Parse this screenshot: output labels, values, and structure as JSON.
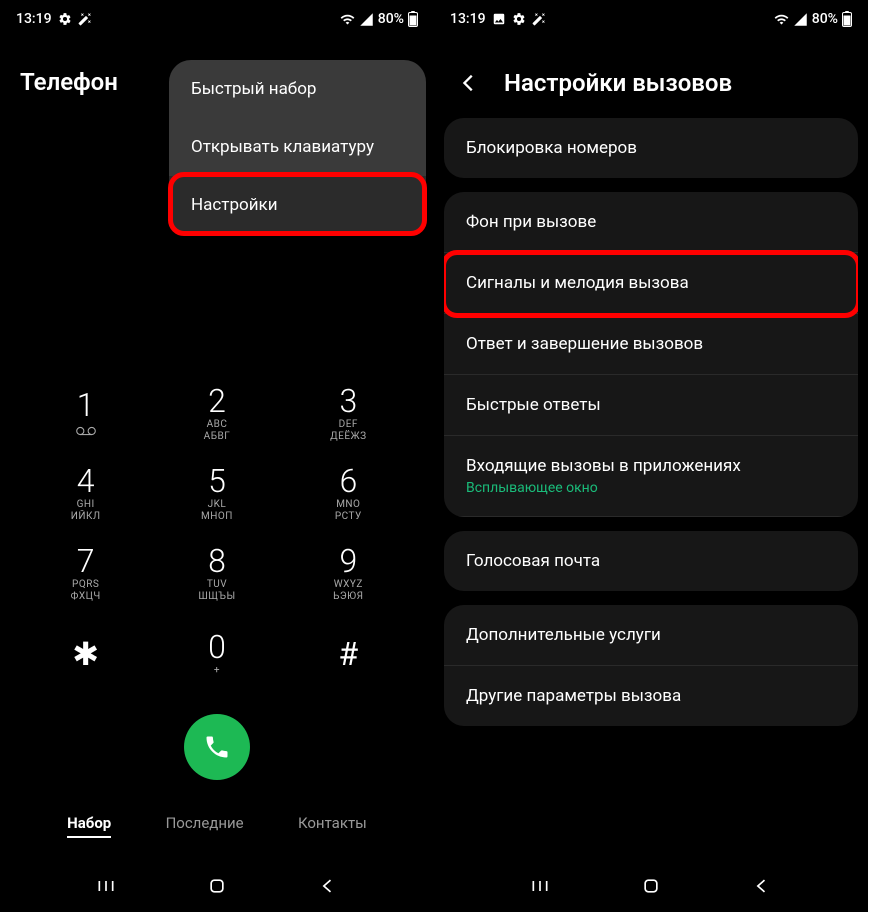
{
  "status": {
    "time": "13:19",
    "battery": "80%"
  },
  "left": {
    "title": "Телефон",
    "menu": {
      "item1": "Быстрый набор",
      "item2": "Открывать клавиатуру",
      "item3": "Настройки"
    },
    "keys": {
      "k1": "1",
      "k2": "2",
      "k2a": "ABC",
      "k2b": "АБВГ",
      "k3": "3",
      "k3a": "DEF",
      "k3b": "ДЕЁЖЗ",
      "k4": "4",
      "k4a": "GHI",
      "k4b": "ИЙКЛ",
      "k5": "5",
      "k5a": "JKL",
      "k5b": "МНОП",
      "k6": "6",
      "k6a": "MNO",
      "k6b": "РСТУ",
      "k7": "7",
      "k7a": "PQRS",
      "k7b": "ФХЦЧ",
      "k8": "8",
      "k8a": "TUV",
      "k8b": "ШЩЪЫ",
      "k9": "9",
      "k9a": "WXYZ",
      "k9b": "ЬЭЮЯ",
      "kstar": "✱",
      "k0": "0",
      "k0a": "+",
      "khash": "#"
    },
    "tabs": {
      "t1": "Набор",
      "t2": "Последние",
      "t3": "Контакты"
    }
  },
  "right": {
    "title": "Настройки вызовов",
    "items": {
      "i1": "Блокировка номеров",
      "i2": "Фон при вызове",
      "i3": "Сигналы и мелодия вызова",
      "i4": "Ответ и завершение вызовов",
      "i5": "Быстрые ответы",
      "i6": "Входящие вызовы в приложениях",
      "i6sub": "Всплывающее окно",
      "i7": "Голосовая почта",
      "i8": "Дополнительные услуги",
      "i9": "Другие параметры вызова"
    }
  }
}
